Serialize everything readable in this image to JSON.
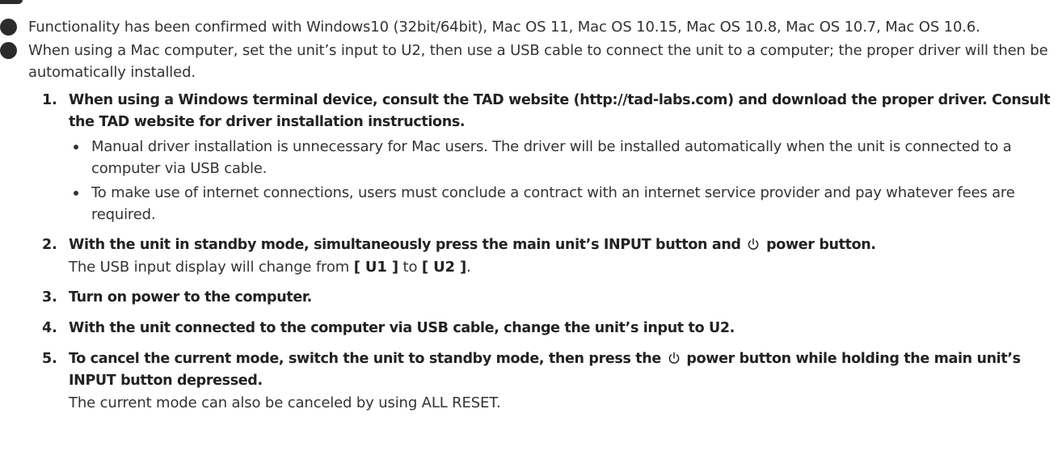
{
  "notes": [
    "Functionality has been confirmed with Windows10 (32bit/64bit), Mac OS 11, Mac OS 10.15, Mac OS 10.8, Mac OS 10.7, Mac OS 10.6.",
    "When using a Mac computer, set the unit’s input to U2, then use a USB cable to connect the unit to a computer; the proper driver will then be automatically installed."
  ],
  "steps": [
    {
      "number": "1.",
      "title": "When using a Windows terminal device, consult the TAD website (http://tad-labs.com) and download the proper driver. Consult the TAD website for driver installation instructions.",
      "bullets": [
        "Manual driver installation is unnecessary for Mac users. The driver will be installed automatically when the unit is connected to a computer via USB cable.",
        "To make use of internet connections, users must conclude a contract with an internet service provider and pay whatever fees are required."
      ]
    },
    {
      "number": "2.",
      "title_before": "With the unit in standby mode, simultaneously press the main unit’s INPUT button and",
      "title_after": "power button.",
      "desc_before": "The USB input display will change from",
      "desc_from": "[ U1 ]",
      "desc_mid": "to",
      "desc_to": "[ U2 ]",
      "desc_end": "."
    },
    {
      "number": "3.",
      "title": "Turn on power to the computer."
    },
    {
      "number": "4.",
      "title": "With the unit connected to the computer via USB cable, change the unit’s input to U2."
    },
    {
      "number": "5.",
      "title_before": "To cancel the current mode, switch the unit to standby mode, then press the",
      "title_after": "power button while holding the main unit’s INPUT button depressed.",
      "desc": "The current mode can also be canceled by using ALL RESET."
    }
  ],
  "icons": {
    "power": "power-icon"
  }
}
